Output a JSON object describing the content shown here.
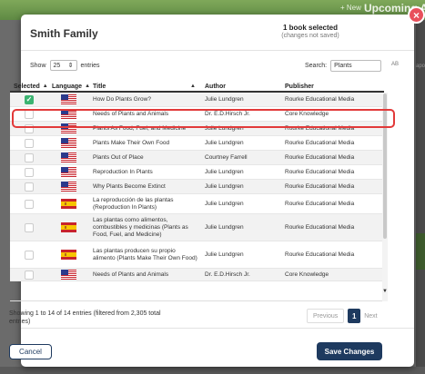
{
  "background": {
    "new_label": "+ New",
    "upcoming_label": "Upcoming A",
    "side_text": "apo"
  },
  "modal": {
    "title": "Smith Family",
    "selection": {
      "count_text": "1 book selected",
      "note": "(changes not saved)"
    },
    "close_label": "×"
  },
  "controls": {
    "show_label": "Show",
    "show_value": "25",
    "entries_label": "entries",
    "search_label": "Search:",
    "search_value": "Plants",
    "ab_mark": "AB"
  },
  "table": {
    "headers": {
      "selected": "Selected",
      "language": "Language",
      "title": "Title",
      "author": "Author",
      "publisher": "Publisher"
    },
    "rows": [
      {
        "checked": true,
        "flag": "us",
        "title": "How Do Plants Grow?",
        "author": "Julie Lundgren",
        "publisher": "Rourke Educational Media"
      },
      {
        "checked": false,
        "flag": "us",
        "title": "Needs of Plants and Animals",
        "author": "Dr. E.D.Hirsch Jr.",
        "publisher": "Core Knowledge"
      },
      {
        "checked": false,
        "flag": "us",
        "title": "Plants As Food, Fuel, and Medicine",
        "author": "Julie Lundgren",
        "publisher": "Rourke Educational Media"
      },
      {
        "checked": false,
        "flag": "us",
        "title": "Plants Make Their Own Food",
        "author": "Julie Lundgren",
        "publisher": "Rourke Educational Media"
      },
      {
        "checked": false,
        "flag": "us",
        "title": "Plants Out of Place",
        "author": "Courtney Farrell",
        "publisher": "Rourke Educational Media"
      },
      {
        "checked": false,
        "flag": "us",
        "title": "Reproduction In Plants",
        "author": "Julie Lundgren",
        "publisher": "Rourke Educational Media"
      },
      {
        "checked": false,
        "flag": "us",
        "title": "Why Plants Become Extinct",
        "author": "Julie Lundgren",
        "publisher": "Rourke Educational Media"
      },
      {
        "checked": false,
        "flag": "es",
        "title": "La reproducción de las plantas (Reproduction In Plants)",
        "author": "Julie Lundgren",
        "publisher": "Rourke Educational Media"
      },
      {
        "checked": false,
        "flag": "es",
        "title": "Las plantas como alimentos, combustibles y medicinas (Plants as Food, Fuel, and Medicine)",
        "author": "Julie Lundgren",
        "publisher": "Rourke Educational Media"
      },
      {
        "checked": false,
        "flag": "es",
        "title": "Las plantas producen su propio alimento (Plants Make Their Own Food)",
        "author": "Julie Lundgren",
        "publisher": "Rourke Educational Media"
      },
      {
        "checked": false,
        "flag": "us",
        "title": "Needs of Plants and Animals",
        "author": "Dr. E.D.Hirsch Jr.",
        "publisher": "Core Knowledge"
      }
    ]
  },
  "footer": {
    "info": "Showing 1 to 14 of 14 entries (filtered from 2,305 total entries)",
    "previous": "Previous",
    "current_page": "1",
    "next": "Next",
    "cancel": "Cancel",
    "save": "Save Changes"
  },
  "colors": {
    "accent": "#1e3a5f",
    "checked": "#3cb371",
    "highlight": "#e23a3a",
    "close": "#e8505b"
  }
}
